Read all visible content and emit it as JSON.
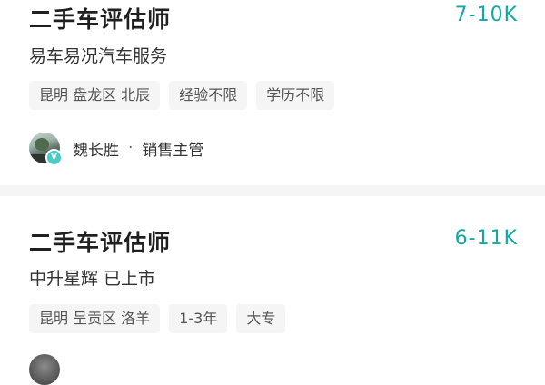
{
  "jobs": [
    {
      "title": "二手车评估师",
      "salary": "7-10K",
      "company": "易车易况汽车服务",
      "tags": [
        "昆明 盘龙区 北辰",
        "经验不限",
        "学历不限"
      ],
      "recruiter": {
        "name": "魏长胜",
        "separator": "·",
        "role": "销售主管",
        "verified_mark": "V"
      }
    },
    {
      "title": "二手车评估师",
      "salary": "6-11K",
      "company": "中升星辉 已上市",
      "tags": [
        "昆明 呈贡区 洛羊",
        "1-3年",
        "大专"
      ]
    }
  ],
  "colors": {
    "salary": "#14a8a2",
    "tag_bg": "#f5f5f5",
    "separator_bg": "#f5f5f5",
    "verified_badge": "#4ccac4"
  },
  "icons": {
    "verified": "verified-icon"
  }
}
